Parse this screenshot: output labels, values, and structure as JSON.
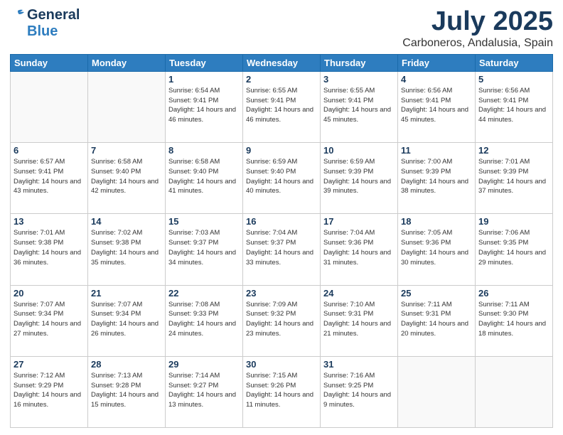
{
  "header": {
    "logo_general": "General",
    "logo_blue": "Blue",
    "title": "July 2025",
    "subtitle": "Carboneros, Andalusia, Spain"
  },
  "calendar": {
    "days_of_week": [
      "Sunday",
      "Monday",
      "Tuesday",
      "Wednesday",
      "Thursday",
      "Friday",
      "Saturday"
    ],
    "weeks": [
      [
        {
          "day": "",
          "sunrise": "",
          "sunset": "",
          "daylight": ""
        },
        {
          "day": "",
          "sunrise": "",
          "sunset": "",
          "daylight": ""
        },
        {
          "day": "1",
          "sunrise": "Sunrise: 6:54 AM",
          "sunset": "Sunset: 9:41 PM",
          "daylight": "Daylight: 14 hours and 46 minutes."
        },
        {
          "day": "2",
          "sunrise": "Sunrise: 6:55 AM",
          "sunset": "Sunset: 9:41 PM",
          "daylight": "Daylight: 14 hours and 46 minutes."
        },
        {
          "day": "3",
          "sunrise": "Sunrise: 6:55 AM",
          "sunset": "Sunset: 9:41 PM",
          "daylight": "Daylight: 14 hours and 45 minutes."
        },
        {
          "day": "4",
          "sunrise": "Sunrise: 6:56 AM",
          "sunset": "Sunset: 9:41 PM",
          "daylight": "Daylight: 14 hours and 45 minutes."
        },
        {
          "day": "5",
          "sunrise": "Sunrise: 6:56 AM",
          "sunset": "Sunset: 9:41 PM",
          "daylight": "Daylight: 14 hours and 44 minutes."
        }
      ],
      [
        {
          "day": "6",
          "sunrise": "Sunrise: 6:57 AM",
          "sunset": "Sunset: 9:41 PM",
          "daylight": "Daylight: 14 hours and 43 minutes."
        },
        {
          "day": "7",
          "sunrise": "Sunrise: 6:58 AM",
          "sunset": "Sunset: 9:40 PM",
          "daylight": "Daylight: 14 hours and 42 minutes."
        },
        {
          "day": "8",
          "sunrise": "Sunrise: 6:58 AM",
          "sunset": "Sunset: 9:40 PM",
          "daylight": "Daylight: 14 hours and 41 minutes."
        },
        {
          "day": "9",
          "sunrise": "Sunrise: 6:59 AM",
          "sunset": "Sunset: 9:40 PM",
          "daylight": "Daylight: 14 hours and 40 minutes."
        },
        {
          "day": "10",
          "sunrise": "Sunrise: 6:59 AM",
          "sunset": "Sunset: 9:39 PM",
          "daylight": "Daylight: 14 hours and 39 minutes."
        },
        {
          "day": "11",
          "sunrise": "Sunrise: 7:00 AM",
          "sunset": "Sunset: 9:39 PM",
          "daylight": "Daylight: 14 hours and 38 minutes."
        },
        {
          "day": "12",
          "sunrise": "Sunrise: 7:01 AM",
          "sunset": "Sunset: 9:39 PM",
          "daylight": "Daylight: 14 hours and 37 minutes."
        }
      ],
      [
        {
          "day": "13",
          "sunrise": "Sunrise: 7:01 AM",
          "sunset": "Sunset: 9:38 PM",
          "daylight": "Daylight: 14 hours and 36 minutes."
        },
        {
          "day": "14",
          "sunrise": "Sunrise: 7:02 AM",
          "sunset": "Sunset: 9:38 PM",
          "daylight": "Daylight: 14 hours and 35 minutes."
        },
        {
          "day": "15",
          "sunrise": "Sunrise: 7:03 AM",
          "sunset": "Sunset: 9:37 PM",
          "daylight": "Daylight: 14 hours and 34 minutes."
        },
        {
          "day": "16",
          "sunrise": "Sunrise: 7:04 AM",
          "sunset": "Sunset: 9:37 PM",
          "daylight": "Daylight: 14 hours and 33 minutes."
        },
        {
          "day": "17",
          "sunrise": "Sunrise: 7:04 AM",
          "sunset": "Sunset: 9:36 PM",
          "daylight": "Daylight: 14 hours and 31 minutes."
        },
        {
          "day": "18",
          "sunrise": "Sunrise: 7:05 AM",
          "sunset": "Sunset: 9:36 PM",
          "daylight": "Daylight: 14 hours and 30 minutes."
        },
        {
          "day": "19",
          "sunrise": "Sunrise: 7:06 AM",
          "sunset": "Sunset: 9:35 PM",
          "daylight": "Daylight: 14 hours and 29 minutes."
        }
      ],
      [
        {
          "day": "20",
          "sunrise": "Sunrise: 7:07 AM",
          "sunset": "Sunset: 9:34 PM",
          "daylight": "Daylight: 14 hours and 27 minutes."
        },
        {
          "day": "21",
          "sunrise": "Sunrise: 7:07 AM",
          "sunset": "Sunset: 9:34 PM",
          "daylight": "Daylight: 14 hours and 26 minutes."
        },
        {
          "day": "22",
          "sunrise": "Sunrise: 7:08 AM",
          "sunset": "Sunset: 9:33 PM",
          "daylight": "Daylight: 14 hours and 24 minutes."
        },
        {
          "day": "23",
          "sunrise": "Sunrise: 7:09 AM",
          "sunset": "Sunset: 9:32 PM",
          "daylight": "Daylight: 14 hours and 23 minutes."
        },
        {
          "day": "24",
          "sunrise": "Sunrise: 7:10 AM",
          "sunset": "Sunset: 9:31 PM",
          "daylight": "Daylight: 14 hours and 21 minutes."
        },
        {
          "day": "25",
          "sunrise": "Sunrise: 7:11 AM",
          "sunset": "Sunset: 9:31 PM",
          "daylight": "Daylight: 14 hours and 20 minutes."
        },
        {
          "day": "26",
          "sunrise": "Sunrise: 7:11 AM",
          "sunset": "Sunset: 9:30 PM",
          "daylight": "Daylight: 14 hours and 18 minutes."
        }
      ],
      [
        {
          "day": "27",
          "sunrise": "Sunrise: 7:12 AM",
          "sunset": "Sunset: 9:29 PM",
          "daylight": "Daylight: 14 hours and 16 minutes."
        },
        {
          "day": "28",
          "sunrise": "Sunrise: 7:13 AM",
          "sunset": "Sunset: 9:28 PM",
          "daylight": "Daylight: 14 hours and 15 minutes."
        },
        {
          "day": "29",
          "sunrise": "Sunrise: 7:14 AM",
          "sunset": "Sunset: 9:27 PM",
          "daylight": "Daylight: 14 hours and 13 minutes."
        },
        {
          "day": "30",
          "sunrise": "Sunrise: 7:15 AM",
          "sunset": "Sunset: 9:26 PM",
          "daylight": "Daylight: 14 hours and 11 minutes."
        },
        {
          "day": "31",
          "sunrise": "Sunrise: 7:16 AM",
          "sunset": "Sunset: 9:25 PM",
          "daylight": "Daylight: 14 hours and 9 minutes."
        },
        {
          "day": "",
          "sunrise": "",
          "sunset": "",
          "daylight": ""
        },
        {
          "day": "",
          "sunrise": "",
          "sunset": "",
          "daylight": ""
        }
      ]
    ]
  }
}
